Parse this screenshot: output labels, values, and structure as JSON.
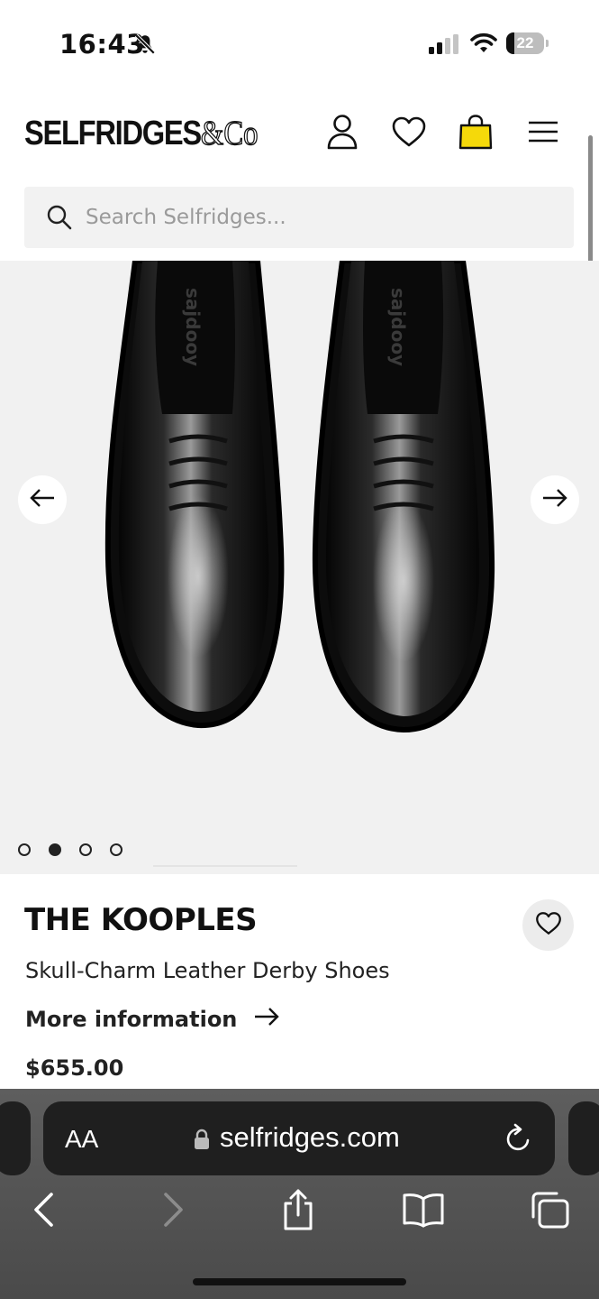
{
  "status_bar": {
    "time": "16:43",
    "battery": "22",
    "battery_level": 0.22
  },
  "header": {
    "logo": "SELFRIDGES",
    "logo_suffix": "&Co",
    "icons": [
      "account-icon",
      "heart-icon",
      "shopping-bag-icon",
      "menu-icon"
    ],
    "bag_color": "#f5d90a"
  },
  "search": {
    "placeholder": "Search Selfridges..."
  },
  "gallery": {
    "slide_count": 4,
    "active_slide": 2,
    "shoe_insole_text": "sajdooy",
    "background": "#f1f1f1"
  },
  "product": {
    "brand": "THE KOOPLES",
    "name": "Skull-Charm Leather Derby Shoes",
    "more_info": "More information",
    "price": "$655.00"
  },
  "browser": {
    "text_size": "AA",
    "url": "selfridges.com"
  }
}
